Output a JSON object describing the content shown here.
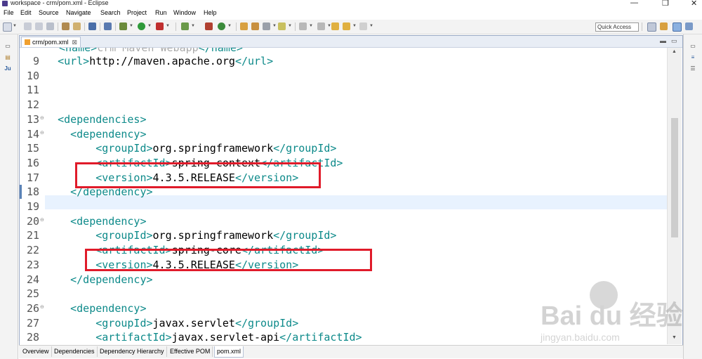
{
  "window": {
    "title": "workspace - crm/pom.xml - Eclipse",
    "controls": [
      "—",
      "❐",
      "✕"
    ]
  },
  "menu": [
    "File",
    "Edit",
    "Source",
    "Navigate",
    "Search",
    "Project",
    "Run",
    "Window",
    "Help"
  ],
  "toolbar": {
    "quick_access": "Quick Access"
  },
  "editor": {
    "tab_label": "crm/pom.xml",
    "tab_close": "⊠",
    "lines": [
      {
        "n": "9",
        "indent": "  ",
        "parts": [
          [
            "tag",
            "<url>"
          ],
          [
            "txt",
            "http://maven.apache.org"
          ],
          [
            "tag",
            "</url>"
          ]
        ]
      },
      {
        "n": "10",
        "indent": "",
        "parts": []
      },
      {
        "n": "11",
        "indent": "",
        "parts": []
      },
      {
        "n": "12",
        "indent": "",
        "parts": []
      },
      {
        "n": "13",
        "indent": "  ",
        "parts": [
          [
            "tag",
            "<dependencies>"
          ]
        ],
        "fold": true
      },
      {
        "n": "14",
        "indent": "    ",
        "parts": [
          [
            "tag",
            "<dependency>"
          ]
        ],
        "fold": true
      },
      {
        "n": "15",
        "indent": "        ",
        "parts": [
          [
            "tag",
            "<groupId>"
          ],
          [
            "txt",
            "org.springframework"
          ],
          [
            "tag",
            "</groupId>"
          ]
        ]
      },
      {
        "n": "16",
        "indent": "        ",
        "parts": [
          [
            "tag",
            "<artifactId>"
          ],
          [
            "txt",
            "spring-context"
          ],
          [
            "tag",
            "</artifactId>"
          ]
        ]
      },
      {
        "n": "17",
        "indent": "        ",
        "parts": [
          [
            "tag",
            "<version>"
          ],
          [
            "txt",
            "4.3.5.RELEASE"
          ],
          [
            "tag",
            "</version>"
          ]
        ]
      },
      {
        "n": "18",
        "indent": "    ",
        "parts": [
          [
            "tag",
            "</dependency>"
          ]
        ]
      },
      {
        "n": "19",
        "indent": "",
        "parts": []
      },
      {
        "n": "20",
        "indent": "    ",
        "parts": [
          [
            "tag",
            "<dependency>"
          ]
        ],
        "fold": true
      },
      {
        "n": "21",
        "indent": "        ",
        "parts": [
          [
            "tag",
            "<groupId>"
          ],
          [
            "txt",
            "org.springframework"
          ],
          [
            "tag",
            "</groupId>"
          ]
        ]
      },
      {
        "n": "22",
        "indent": "        ",
        "parts": [
          [
            "tag",
            "<artifactId>"
          ],
          [
            "txt",
            "spring-core"
          ],
          [
            "tag",
            "</artifactId>"
          ]
        ]
      },
      {
        "n": "23",
        "indent": "        ",
        "parts": [
          [
            "tag",
            "<version>"
          ],
          [
            "txt",
            "4.3.5.RELEASE"
          ],
          [
            "tag",
            "</version>"
          ]
        ]
      },
      {
        "n": "24",
        "indent": "    ",
        "parts": [
          [
            "tag",
            "</dependency>"
          ]
        ]
      },
      {
        "n": "25",
        "indent": "",
        "parts": []
      },
      {
        "n": "26",
        "indent": "    ",
        "parts": [
          [
            "tag",
            "<dependency>"
          ]
        ],
        "fold": true
      },
      {
        "n": "27",
        "indent": "        ",
        "parts": [
          [
            "tag",
            "<groupId>"
          ],
          [
            "txt",
            "javax.servlet"
          ],
          [
            "tag",
            "</groupId>"
          ]
        ]
      },
      {
        "n": "28",
        "indent": "        ",
        "parts": [
          [
            "tag",
            "<artifactId>"
          ],
          [
            "txt",
            "javax.servlet-api"
          ],
          [
            "tag",
            "</artifactId>"
          ]
        ]
      }
    ],
    "current_line": "18"
  },
  "bottom_tabs": [
    "Overview",
    "Dependencies",
    "Dependency Hierarchy",
    "Effective POM",
    "pom.xml"
  ],
  "bottom_tab_active": "pom.xml",
  "watermark": {
    "brand": "Bai du 经验",
    "url": "jingyan.baidu.com"
  },
  "colors": {
    "tag": "#0d8a8a",
    "highlight_box": "#e01b2a",
    "current_line": "#e8f2fe"
  }
}
